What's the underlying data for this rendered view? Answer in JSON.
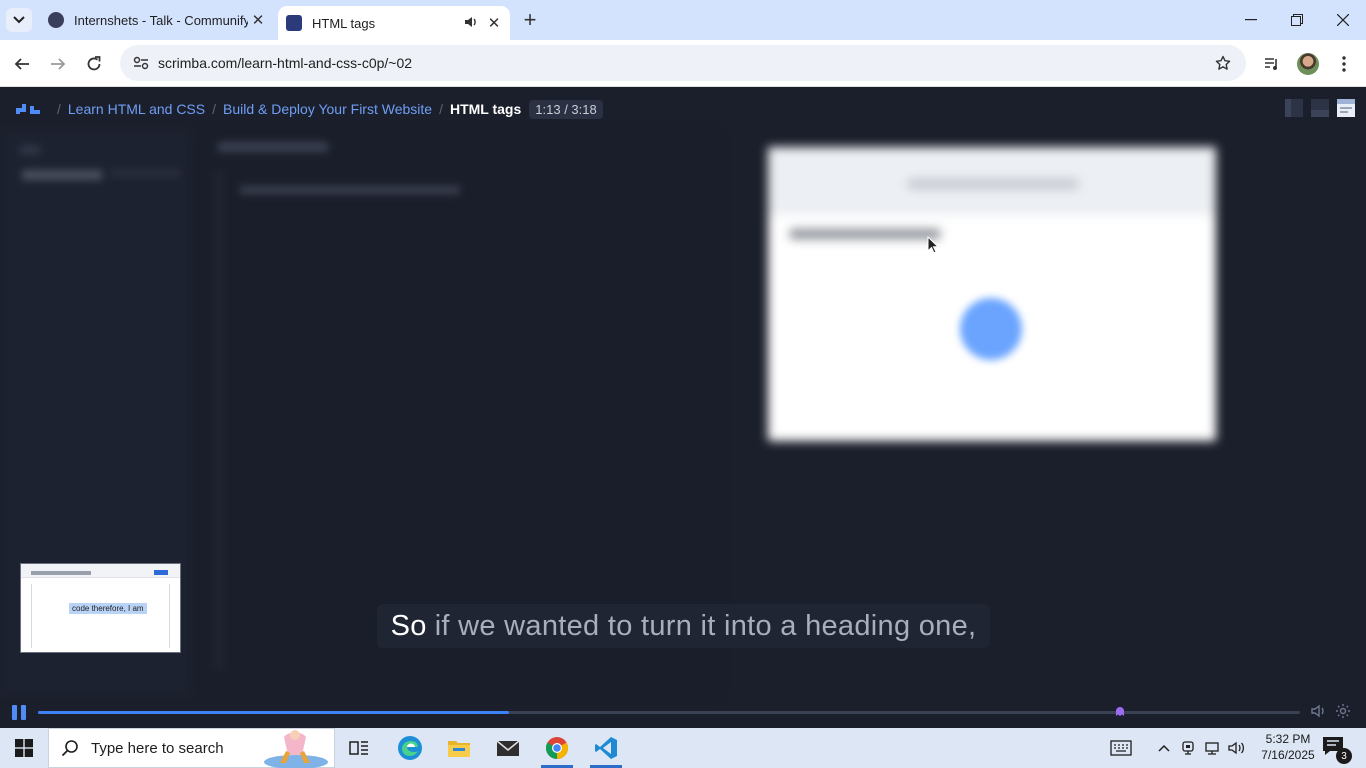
{
  "browser": {
    "tabs": [
      {
        "title": "Internshets - Talk - Communify",
        "favicon": "communify-icon"
      },
      {
        "title": "HTML tags",
        "favicon": "scrimba-icon",
        "active": true,
        "audio": true
      }
    ],
    "url": "scrimba.com/learn-html-and-css-c0p/~02"
  },
  "app": {
    "breadcrumb": [
      "Learn HTML and CSS",
      "Build & Deploy Your First Website",
      "HTML tags"
    ],
    "separator": "/",
    "time": "1:13 / 3:18",
    "caption": {
      "spoken": "So",
      "rest": "if we wanted to turn it into a heading one,"
    },
    "webcam_text": "code therefore, I am",
    "player": {
      "progress": 0.373,
      "marker_position": 0.857
    },
    "accent": "#3c82f6"
  },
  "taskbar": {
    "search_placeholder": "Type here to search",
    "time": "5:32 PM",
    "date": "7/16/2025",
    "notifications": "3",
    "pinned": [
      "task-view-icon",
      "edge-icon",
      "file-explorer-icon",
      "mail-icon",
      "chrome-icon",
      "vscode-icon"
    ]
  }
}
